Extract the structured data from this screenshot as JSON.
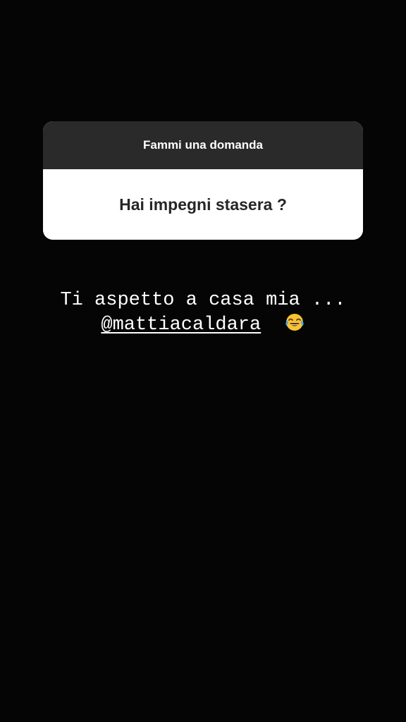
{
  "question_sticker": {
    "header": "Fammi una domanda",
    "question": "Hai impegni stasera ?"
  },
  "caption": {
    "line1": "Ti aspetto a casa mia ...",
    "mention": "@mattiacaldara",
    "emoji": "tears-of-joy-icon"
  },
  "colors": {
    "background": "#050505",
    "sticker_header": "#2a2a2b",
    "sticker_body": "#ffffff",
    "text_dark": "#262626",
    "text_light": "#ffffff"
  }
}
